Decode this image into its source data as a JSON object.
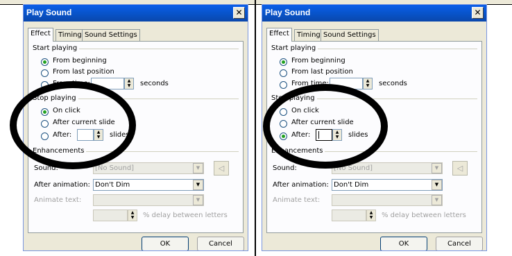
{
  "dialogs": [
    {
      "title": "Play Sound",
      "tabs": [
        "Effect",
        "Timing",
        "Sound Settings"
      ],
      "start_playing": {
        "label": "Start playing",
        "options": [
          "From beginning",
          "From last position",
          "From time:"
        ],
        "selected": 0,
        "time_value": "",
        "seconds_label": "seconds"
      },
      "stop_playing": {
        "label": "Stop playing",
        "options": [
          "On click",
          "After current slide",
          "After:"
        ],
        "selected": 0,
        "after_value": "",
        "slides_label": "slides"
      },
      "enhancements": {
        "label": "Enhancements",
        "sound_label": "Sound:",
        "sound_value": "[No Sound]",
        "after_animation_label": "After animation:",
        "after_animation_value": "Don't Dim",
        "animate_text_label": "Animate text:",
        "animate_text_value": "",
        "delay_label": "% delay between letters"
      },
      "ok_label": "OK",
      "cancel_label": "Cancel"
    },
    {
      "title": "Play Sound",
      "tabs": [
        "Effect",
        "Timing",
        "Sound Settings"
      ],
      "start_playing": {
        "label": "Start playing",
        "options": [
          "From beginning",
          "From last position",
          "From time:"
        ],
        "selected": 0,
        "time_value": "",
        "seconds_label": "seconds"
      },
      "stop_playing": {
        "label": "Stop playing",
        "options": [
          "On click",
          "After current slide",
          "After:"
        ],
        "selected": 2,
        "after_value": "",
        "slides_label": "slides"
      },
      "enhancements": {
        "label": "Enhancements",
        "sound_label": "Sound:",
        "sound_value": "[No Sound]",
        "after_animation_label": "After animation:",
        "after_animation_value": "Don't Dim",
        "animate_text_label": "Animate text:",
        "animate_text_value": "",
        "delay_label": "% delay between letters"
      },
      "ok_label": "OK",
      "cancel_label": "Cancel"
    }
  ],
  "icons": {
    "close": "close-icon",
    "spin": "spin-arrows-icon",
    "dropdown": "chevron-down-icon",
    "speaker": "speaker-icon"
  }
}
